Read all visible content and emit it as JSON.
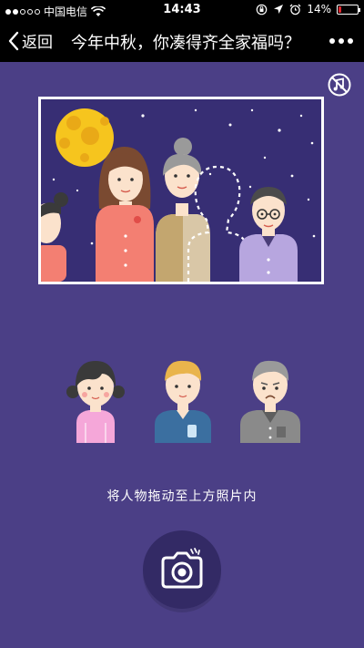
{
  "status_bar": {
    "carrier": "中国电信",
    "time": "14:43",
    "battery_percent": "14%",
    "battery_level": 0.14,
    "icons": [
      "signal-dots-icon",
      "wifi-icon",
      "orientation-lock-icon",
      "location-arrow-icon",
      "alarm-icon",
      "battery-icon"
    ]
  },
  "nav": {
    "back_label": "返回",
    "title": "今年中秋，你凑得齐全家福吗？",
    "icons": [
      "back-arrow-icon",
      "more-dots-icon"
    ]
  },
  "scene": {
    "icons": [
      "music-off-icon",
      "full-moon-icon",
      "star-icons",
      "mother-figure-icon",
      "grandmother-figure-icon",
      "empty-silhouette-slot-icon",
      "grandfather-glasses-figure-icon",
      "girl-partial-figure-icon"
    ]
  },
  "characters": [
    {
      "name": "girl",
      "icon": "girl-character-icon"
    },
    {
      "name": "father",
      "icon": "father-character-icon"
    },
    {
      "name": "grandfather",
      "icon": "grandfather-character-icon"
    }
  ],
  "hint_text": "将人物拖动至上方照片内",
  "camera": {
    "icon": "camera-icon"
  },
  "colors": {
    "background": "#4b3f86",
    "photo_sky": "#372e74",
    "moon": "#f6c51e",
    "battery_low": "#e0262e"
  }
}
